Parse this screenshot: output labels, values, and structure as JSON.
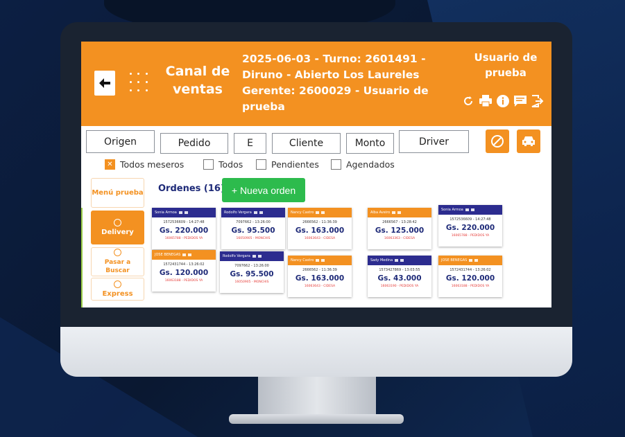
{
  "header": {
    "title": "Canal de ventas",
    "shift_info": "2025-06-03 - Turno: 2601491 - Diruno - Abierto Los Laureles Gerente: 2600029 - Usuario de prueba",
    "user": "Usuario de prueba"
  },
  "filters": {
    "origen": "Origen",
    "pedido": "Pedido",
    "e": "E",
    "cliente": "Cliente",
    "monto": "Monto",
    "driver": "Driver"
  },
  "checks": [
    {
      "label": "Todos meseros",
      "checked": true
    },
    {
      "label": "Todos",
      "checked": false
    },
    {
      "label": "Pendientes",
      "checked": false
    },
    {
      "label": "Agendados",
      "checked": false
    }
  ],
  "side_menu": {
    "menu": "Menú prueba",
    "delivery": "Delivery",
    "pasar": "Pasar a Buscar",
    "express": "Express"
  },
  "orders": {
    "label": "Ordenes (16)",
    "new_button": "+ Nueva orden"
  },
  "colors": {
    "orange": "#f39121",
    "navy": "#2c2c8f",
    "green": "#2dbb4d"
  },
  "cards": [
    {
      "name": "Sonia Armoa",
      "id": "1572536609 - 14:27:48",
      "amount": "Gs. 220.000",
      "source": "16065788 - PEDIDOS YA",
      "color": "blue"
    },
    {
      "name": "Rodolfo Vergara",
      "id": "7097662 - 13:26:00",
      "amount": "Gs. 95.500",
      "source": "16050905 - MONCHIS",
      "color": "blue"
    },
    {
      "name": "Nancy Castro",
      "id": "2666562 - 11:36:39",
      "amount": "Gs. 163.000",
      "source": "16063643 - CIDESA",
      "color": "orange"
    },
    {
      "name": "Alba Aveiro",
      "id": "2666567 - 13:28:42",
      "amount": "Gs. 125.000",
      "source": "16063363 - CIDESA",
      "color": "orange"
    },
    {
      "name": "Sonia Armoa",
      "id": "1572536609 - 14:27:48",
      "amount": "Gs. 220.000",
      "source": "16065788 - PEDIDOS YA",
      "color": "blue"
    },
    {
      "name": "JOSE BENEGAS",
      "id": "1572431744 - 13:26:02",
      "amount": "Gs. 120.000",
      "source": "16063188 - PEDIDOS YA",
      "color": "orange"
    },
    {
      "name": "Rodolfo Vergara",
      "id": "7097662 - 13:26:00",
      "amount": "Gs. 95.500",
      "source": "16050905 - MONCHIS",
      "color": "blue"
    },
    {
      "name": "Nancy Castro",
      "id": "2666562 - 11:36:39",
      "amount": "Gs. 163.000",
      "source": "16063643 - CIDESA",
      "color": "orange"
    },
    {
      "name": "Sady Medina",
      "id": "1573427869 - 13:03:55",
      "amount": "Gs. 43.000",
      "source": "16063190 - PEDIDOS YA",
      "color": "blue"
    },
    {
      "name": "JOSE BENEGAS",
      "id": "1572431744 - 13:26:02",
      "amount": "Gs. 120.000",
      "source": "16063188 - PEDIDOS YA",
      "color": "orange"
    }
  ]
}
